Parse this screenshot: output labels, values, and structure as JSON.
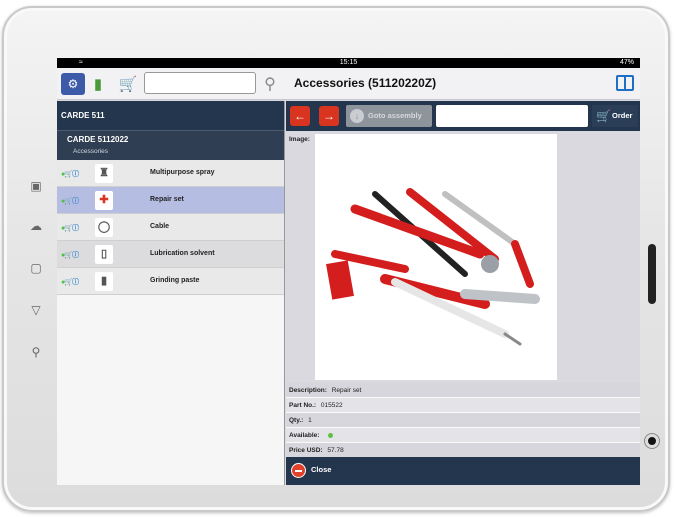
{
  "status_bar": {
    "time": "15:15",
    "battery": "47%"
  },
  "toolbar": {
    "search_value": "",
    "title": "Accessories (51120220Z)"
  },
  "left_panel": {
    "header": "CARDE 511",
    "assembly_title": "CARDE 5112022",
    "assembly_subtitle": "Accessories",
    "items": [
      {
        "label": "Multipurpose spray",
        "selected": false
      },
      {
        "label": "Repair set",
        "selected": true
      },
      {
        "label": "Cable",
        "selected": false
      },
      {
        "label": "Lubrication solvent",
        "selected": false
      },
      {
        "label": "Grinding paste",
        "selected": false
      }
    ]
  },
  "right_panel": {
    "goto_label": "Goto assembly",
    "order_label": "Order",
    "image_label": "Image:",
    "details": {
      "description_label": "Description:",
      "description_value": "Repair set",
      "part_no_label": "Part No.:",
      "part_no_value": "015522",
      "qty_label": "Qty.:",
      "qty_value": "1",
      "available_label": "Available:",
      "price_label": "Price USD:",
      "price_value": "57.78"
    },
    "close_label": "Close"
  },
  "colors": {
    "header_dark": "#24364d",
    "accent_red": "#d8341f",
    "selected_row": "#b6bde3",
    "available_green": "#5fc144"
  }
}
